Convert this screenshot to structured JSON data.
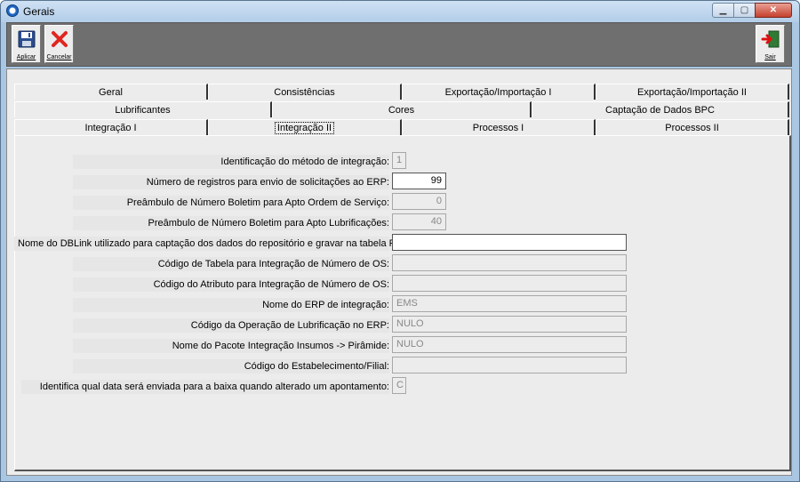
{
  "window": {
    "title": "Gerais"
  },
  "toolbar": {
    "apply_label": "Aplicar",
    "cancel_label": "Cancelar",
    "exit_label": "Sair"
  },
  "tabs": {
    "row1": [
      "Geral",
      "Consistências",
      "Exportação/Importação I",
      "Exportação/Importação II"
    ],
    "row2": [
      "Lubrificantes",
      "Cores",
      "Captação de Dados BPC"
    ],
    "row3": [
      "Integração I",
      "Integração II",
      "Processos I",
      "Processos II"
    ],
    "active": "Integração II"
  },
  "form": {
    "fields": [
      {
        "label": "Identificação do método de integração:",
        "value": "1"
      },
      {
        "label": "Número de registros para envio de solicitações ao ERP:",
        "value": "99"
      },
      {
        "label": "Preâmbulo de Número Boletim para Apto Ordem de Serviço:",
        "value": "0"
      },
      {
        "label": "Preâmbulo de Número Boletim para Apto Lubrificações:",
        "value": "40"
      },
      {
        "label": "Nome do DBLink utilizado para captação dos dados do repositório e gravar na tabela PIMS.:",
        "value": ""
      },
      {
        "label": "Código de Tabela para Integração de Número de OS:",
        "value": ""
      },
      {
        "label": "Código do Atributo para Integração de Número de OS:",
        "value": ""
      },
      {
        "label": "Nome do ERP de integração:",
        "value": "EMS"
      },
      {
        "label": "Código da Operação de Lubrificação no ERP:",
        "value": "NULO"
      },
      {
        "label": "Nome do Pacote Integração Insumos -> Pirâmide:",
        "value": "NULO"
      },
      {
        "label": "Código do Estabelecimento/Filial:",
        "value": ""
      },
      {
        "label": "Identifica qual data será enviada para a baixa quando alterado um apontamento:",
        "value": "C"
      }
    ]
  }
}
